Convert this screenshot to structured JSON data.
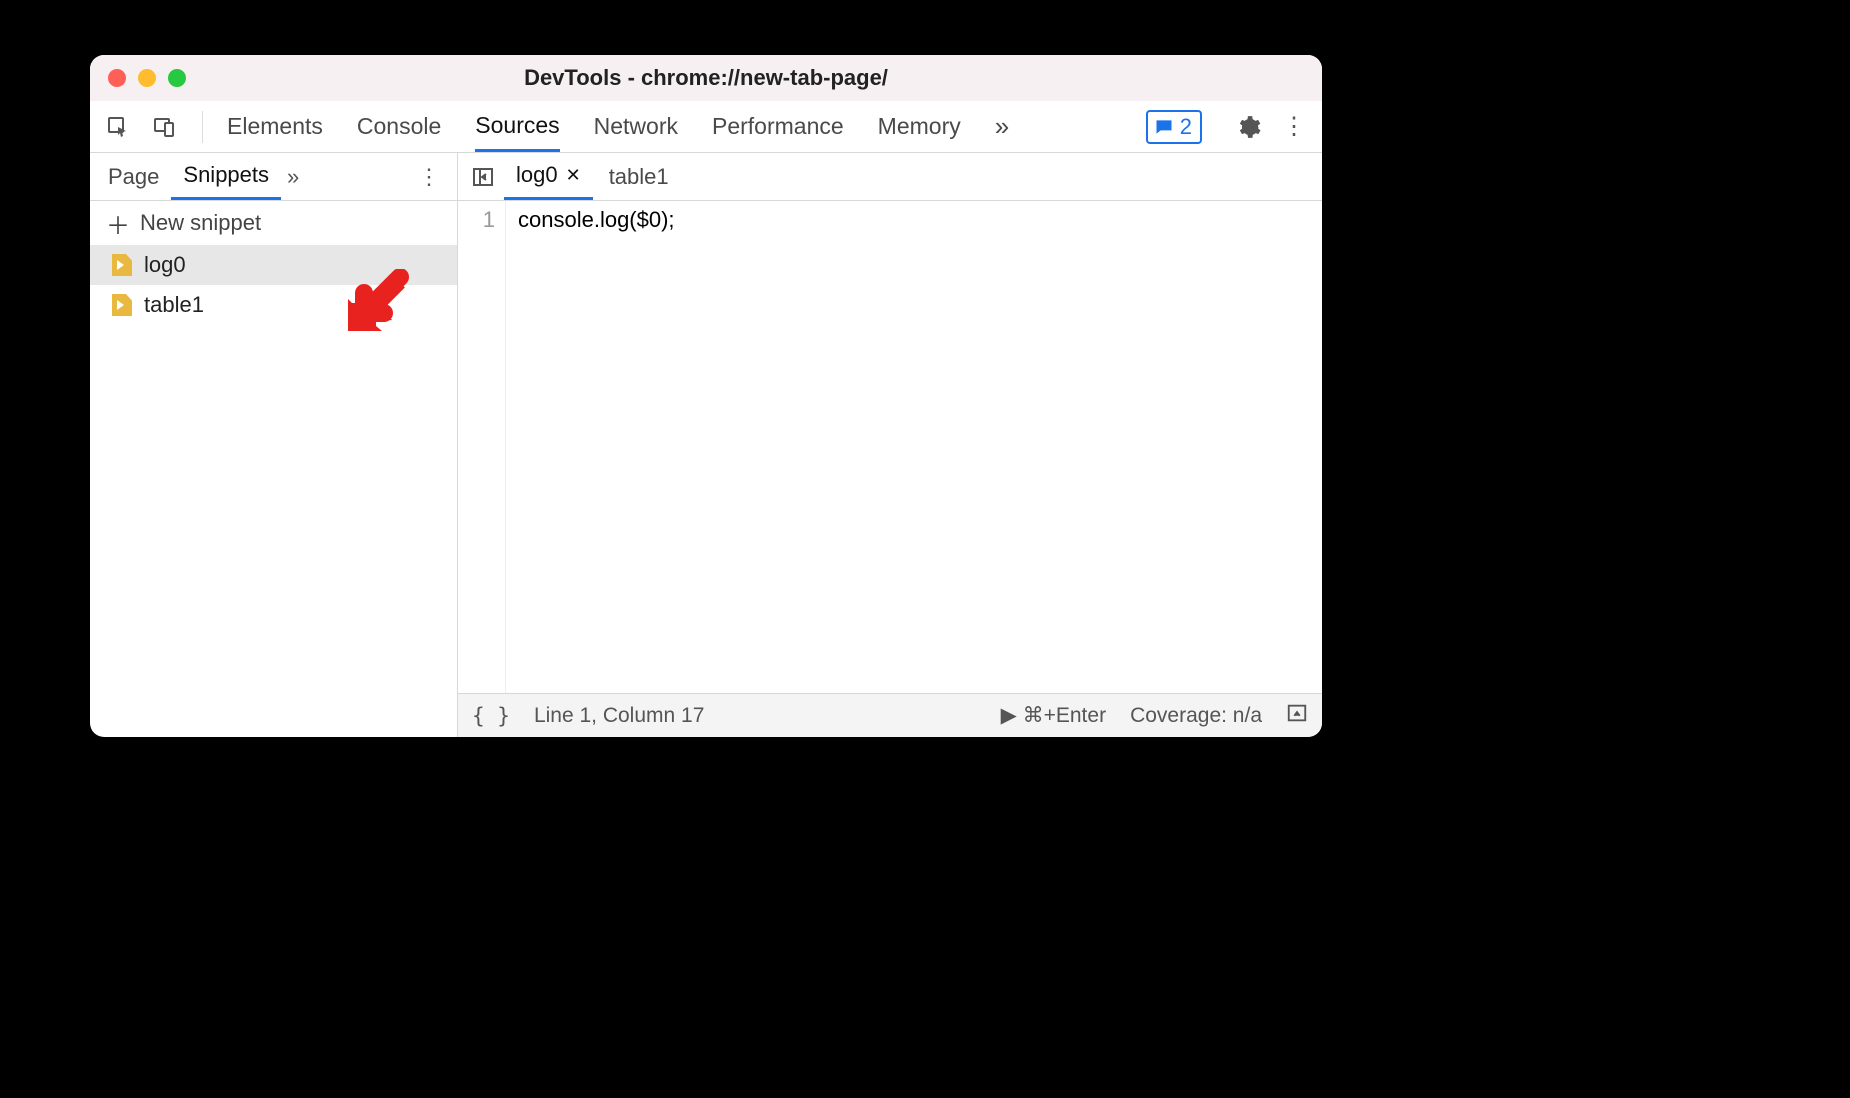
{
  "window": {
    "title": "DevTools - chrome://new-tab-page/"
  },
  "toolbar": {
    "tabs": [
      "Elements",
      "Console",
      "Sources",
      "Network",
      "Performance",
      "Memory"
    ],
    "active_tab": "Sources",
    "overflow_glyph": "»",
    "messages_count": "2"
  },
  "sidebar": {
    "tabs": [
      "Page",
      "Snippets"
    ],
    "active_tab": "Snippets",
    "overflow_glyph": "»",
    "new_snippet_label": "New snippet",
    "files": [
      {
        "name": "log0",
        "selected": true
      },
      {
        "name": "table1",
        "selected": false
      }
    ]
  },
  "editor": {
    "open_tabs": [
      {
        "name": "log0",
        "active": true,
        "closeable": true
      },
      {
        "name": "table1",
        "active": false,
        "closeable": false
      }
    ],
    "lines": [
      {
        "num": "1",
        "text": "console.log($0);"
      }
    ]
  },
  "statusbar": {
    "cursor": "Line 1, Column 17",
    "run_hint": "⌘+Enter",
    "coverage": "Coverage: n/a"
  }
}
